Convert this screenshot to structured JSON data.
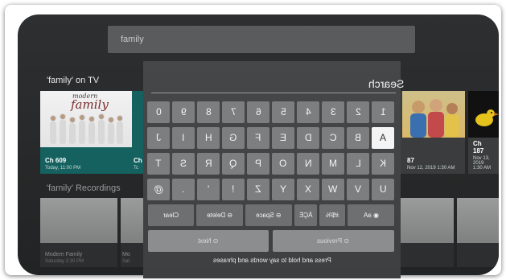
{
  "search": {
    "query": "family"
  },
  "sections": {
    "on_tv": "'family' on TV",
    "recordings": "'family' Recordings"
  },
  "on_tv_cards": [
    {
      "logo_small": "modern",
      "logo_big": "family",
      "channel": "Ch 609",
      "time": "Today, 11:00 PM"
    },
    {
      "channel": "Ch",
      "time": "Tc"
    },
    {
      "channel": "87",
      "time": "Nov 12, 2019 1:30 AM"
    },
    {
      "channel": "Ch 187",
      "time": "Nov 13, 2019 1:30 AM"
    }
  ],
  "recording_cards": [
    {
      "channel": "Modern Family",
      "time": "Saturday 2:30 PM"
    },
    {
      "channel": "Mo",
      "time": "Sat"
    }
  ],
  "keyboard": {
    "input_label": "Search",
    "rows": [
      [
        "1",
        "2",
        "3",
        "4",
        "5",
        "6",
        "7",
        "8",
        "9",
        "0"
      ],
      [
        "A",
        "B",
        "C",
        "D",
        "E",
        "F",
        "G",
        "H",
        "I",
        "J"
      ],
      [
        "K",
        "L",
        "M",
        "N",
        "O",
        "P",
        "Q",
        "R",
        "S",
        "T"
      ],
      [
        "U",
        "V",
        "W",
        "X",
        "Y",
        "Z",
        "!",
        "'",
        ".",
        "@"
      ]
    ],
    "func_row": [
      "aA",
      "#$%",
      "ÄÇÉ",
      "Space",
      "Delete",
      "Clear"
    ],
    "nav_row": [
      "Previous",
      "Next"
    ],
    "hint": "Press and hold  to say words and phrases",
    "selected_key": "A"
  },
  "colors": {
    "accent_card": "#14615f",
    "panel": "#454749",
    "key": "#7c7e80"
  }
}
